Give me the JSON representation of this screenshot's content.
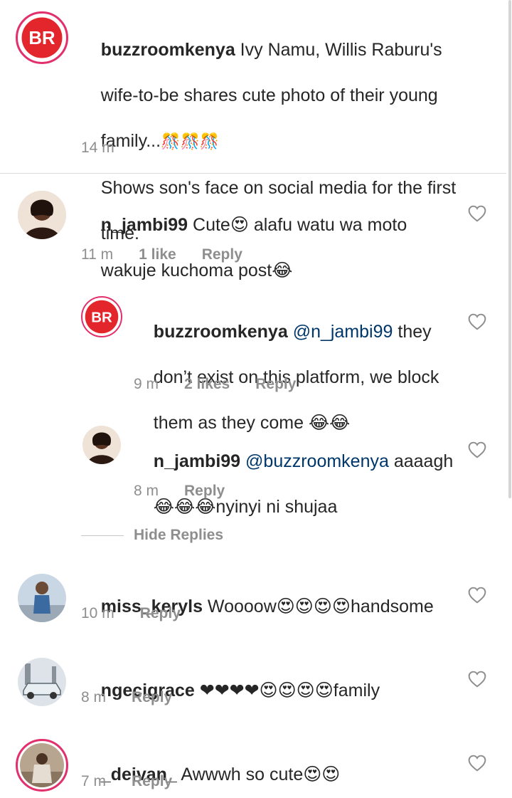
{
  "colors": {
    "brand_red": "#e3262b",
    "text": "#262626",
    "muted": "#8e8e8e",
    "divider": "#dbdbdb"
  },
  "caption": {
    "username": "buzzroomkenya",
    "text_line1": " Ivy Namu, Willis Raburu's",
    "text_line2": "wife-to-be shares cute photo of their young",
    "text_line3": "family...",
    "text_line3_emoji": "🎊🎊🎊",
    "text_line4": "Shows son's face on social media for the first",
    "text_line5": "time.",
    "time": "14 m",
    "avatar_icon": "buzzroom-logo-icon"
  },
  "comments": [
    {
      "username": "n_jambi99",
      "line1": " Cute😍 alafu watu wa moto",
      "line2": "wakuje kuchoma post😂",
      "time": "11 m",
      "likes": "1 like",
      "reply_label": "Reply",
      "avatar_icon": "user-avatar-icon"
    },
    {
      "username": "buzzroomkenya",
      "mention": "@n_jambi99",
      "line1_rest": " they",
      "line2": "don’t exist on this platform, we block",
      "line3": "them as they come 😂😂",
      "time": "9 m",
      "likes": "2 likes",
      "reply_label": "Reply",
      "avatar_icon": "buzzroom-logo-icon"
    },
    {
      "username": "n_jambi99",
      "mention": "@buzzroomkenya",
      "line1_rest": " aaaagh",
      "line2": "😂😂😂nyinyi ni shujaa",
      "time": "8 m",
      "reply_label": "Reply",
      "avatar_icon": "user-avatar-icon"
    },
    {
      "username": "miss_keryls",
      "line1": " Woooow😍😍😍😍handsome",
      "time": "10 m",
      "reply_label": "Reply",
      "avatar_icon": "user-avatar-icon"
    },
    {
      "username": "ngecigrace",
      "line1": " ❤❤❤❤😍😍😍😍family",
      "time": "8 m",
      "reply_label": "Reply",
      "avatar_icon": "car-avatar-icon"
    },
    {
      "username": "_deivan_",
      "line1": " Awwwh so cute😍😍",
      "time": "7 m",
      "reply_label": "Reply",
      "avatar_icon": "user-avatar-icon"
    }
  ],
  "hide_replies_label": "Hide Replies"
}
